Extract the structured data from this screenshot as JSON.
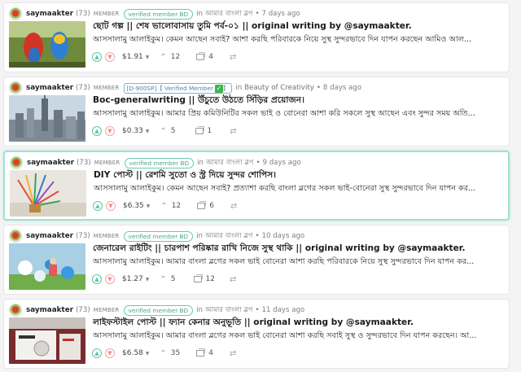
{
  "posts": [
    {
      "author": "saymaakter",
      "reputation": "(73)",
      "role": "MEMBER",
      "badge": "verified member BD",
      "in_label": "in",
      "community": "আমার বাংলা ব্লগ",
      "time": "7 days ago",
      "title": "ছোট গল্প || শেষ ভালোবাসায় তুমি পর্ব-০১ || original writing by @saymaakter.",
      "snippet": "আসসালামু আলাইকুম। কেমন আছেন সবাই? আশা করছি পরিবারকে নিয়ে সুস্থ সুন্দরভাবে দিন যাপন করছেন আমিও আল...",
      "payout": "$1.91",
      "votes": "12",
      "comments": "4",
      "thumb_icon": "parrots-thumbnail"
    },
    {
      "author": "saymaakter",
      "reputation": "(73)",
      "role": "MEMBER",
      "badge": "[D-900SP]【 Verified Member",
      "badge_check": "✓",
      "badge_end": "】",
      "in_label": "in",
      "community": "Beauty of Creativity",
      "time": "8 days ago",
      "title": "Boc-generalwriting || উঁচুতে উঠতে সিঁড়ির প্রয়োজন।",
      "snippet": "আসসালামু আলাইকুম। আমার প্রিয় কমিউনিটির সকল ভাই ও বোনেরা আশা করি সকলে সুস্থ আছেন এবং সুন্দর সময় অতি...",
      "payout": "$0.33",
      "votes": "5",
      "comments": "1",
      "thumb_icon": "city-skyline-thumbnail"
    },
    {
      "author": "saymaakter",
      "reputation": "(73)",
      "role": "MEMBER",
      "badge": "verified member BD",
      "in_label": "in",
      "community": "আমার বাংলা ব্লগ",
      "time": "9 days ago",
      "title": "DIY পোস্ট || রেশমি সুতো ও স্ট্র দিয়ে সুন্দর শোপিস।",
      "snippet": "আসসালামু আলাইকুম। কেমন আছেন সবাই? প্রত্যাশা করছি বাংলা ব্লগের সকল ভাই-বোনেরা সুস্থ সুন্দরভাবে দিন যাপন কর...",
      "payout": "$6.35",
      "votes": "12",
      "comments": "6",
      "thumb_icon": "diy-showpiece-thumbnail"
    },
    {
      "author": "saymaakter",
      "reputation": "(73)",
      "role": "MEMBER",
      "badge": "verified member BD",
      "in_label": "in",
      "community": "আমার বাংলা ব্লগ",
      "time": "10 days ago",
      "title": "জেনারেল রাইটিং || চারপাশ পরিষ্কার রাখি নিজে সুস্থ থাকি || original writing by @saymaakter.",
      "snippet": "আসসালামু আলাইকুম। আমার বাংলা ব্লগের সকল ভাই বোনেরা আশা করছি পরিবারকে নিয়ে সুস্থ সুন্দরভাবে দিন যাপন কর...",
      "payout": "$1.27",
      "votes": "5",
      "comments": "12",
      "thumb_icon": "child-balloons-thumbnail"
    },
    {
      "author": "saymaakter",
      "reputation": "(73)",
      "role": "MEMBER",
      "badge": "verified member BD",
      "in_label": "in",
      "community": "আমার বাংলা ব্লগ",
      "time": "11 days ago",
      "title": "লাইফস্টাইল পোস্ট || ফ্যান কেনার অনুভূতি || original writing by @saymaakter.",
      "snippet": "আসসালামু আলাইকুম। আমার বাংলা ব্লগের সকল ভাই বোনেরা আশা করছি সবাই সুস্থ ও সুন্দরভাবে দিন যাপন করছেন। আ...",
      "payout": "$6.58",
      "votes": "35",
      "comments": "4",
      "thumb_icon": "fan-box-thumbnail"
    }
  ],
  "icons": {
    "upvote": "▲",
    "downvote": "▼",
    "caret": "▼",
    "voters": "⌃",
    "reblog": "⇄",
    "separator": "•"
  },
  "colors": {
    "upvote": "#59c8a4",
    "downvote": "#ee8c8c",
    "badge": "#6cc7b1",
    "highlight_border": "#9de3d0"
  }
}
